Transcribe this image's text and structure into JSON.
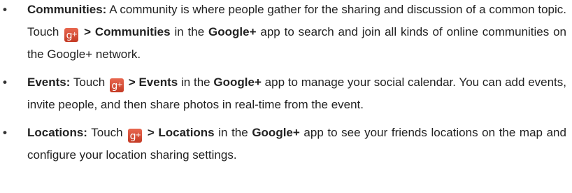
{
  "items": [
    {
      "bullet": "•",
      "term": "Communities:",
      "text1": " A community is where people gather for the sharing and discussion of a common topic. Touch ",
      "icon": "google-plus-icon",
      "nav_label": " > Communities",
      "text2": " in the ",
      "app": "Google+",
      "text3": " app to search and join all kinds of online communities on the Google+ network."
    },
    {
      "bullet": "•",
      "term": "Events:",
      "text1": " Touch ",
      "icon": "google-plus-icon",
      "nav_label": " > Events",
      "text2": " in the ",
      "app": "Google+",
      "text3": " app to manage your social calendar. You can add events, invite people, and then share photos in real-time from the event."
    },
    {
      "bullet": "•",
      "term": "Locations:",
      "text1": " Touch ",
      "icon": "google-plus-icon",
      "nav_label": " > Locations",
      "text2": " in the ",
      "app": "Google+",
      "text3": " app to see your friends locations on the map and configure your location sharing settings."
    }
  ],
  "colors": {
    "text": "#222222",
    "icon_bg": "#d9503a",
    "icon_fg": "#ffffff"
  }
}
